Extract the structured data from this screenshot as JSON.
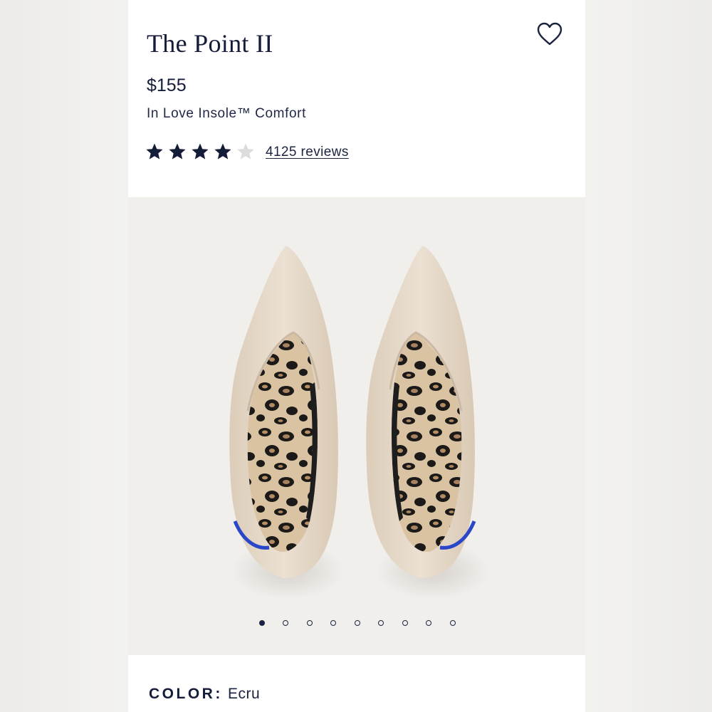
{
  "product": {
    "title": "The Point II",
    "price": "$155",
    "tagline": "In Love Insole™ Comfort",
    "rating": {
      "value": 4,
      "max": 5
    },
    "reviews_label": "4125 reviews",
    "favorite_icon": "heart-outline-icon"
  },
  "gallery": {
    "image_description_icon": "pointed-flat-shoes-pair",
    "slide_count": 9,
    "active_slide": 1
  },
  "color": {
    "label": "COLOR:",
    "value": "Ecru"
  },
  "colors": {
    "navy": "#1b2340",
    "star_empty": "#d8d8d8",
    "shoe_knit": "#e8dccd",
    "heel_accent": "#2947c8"
  }
}
